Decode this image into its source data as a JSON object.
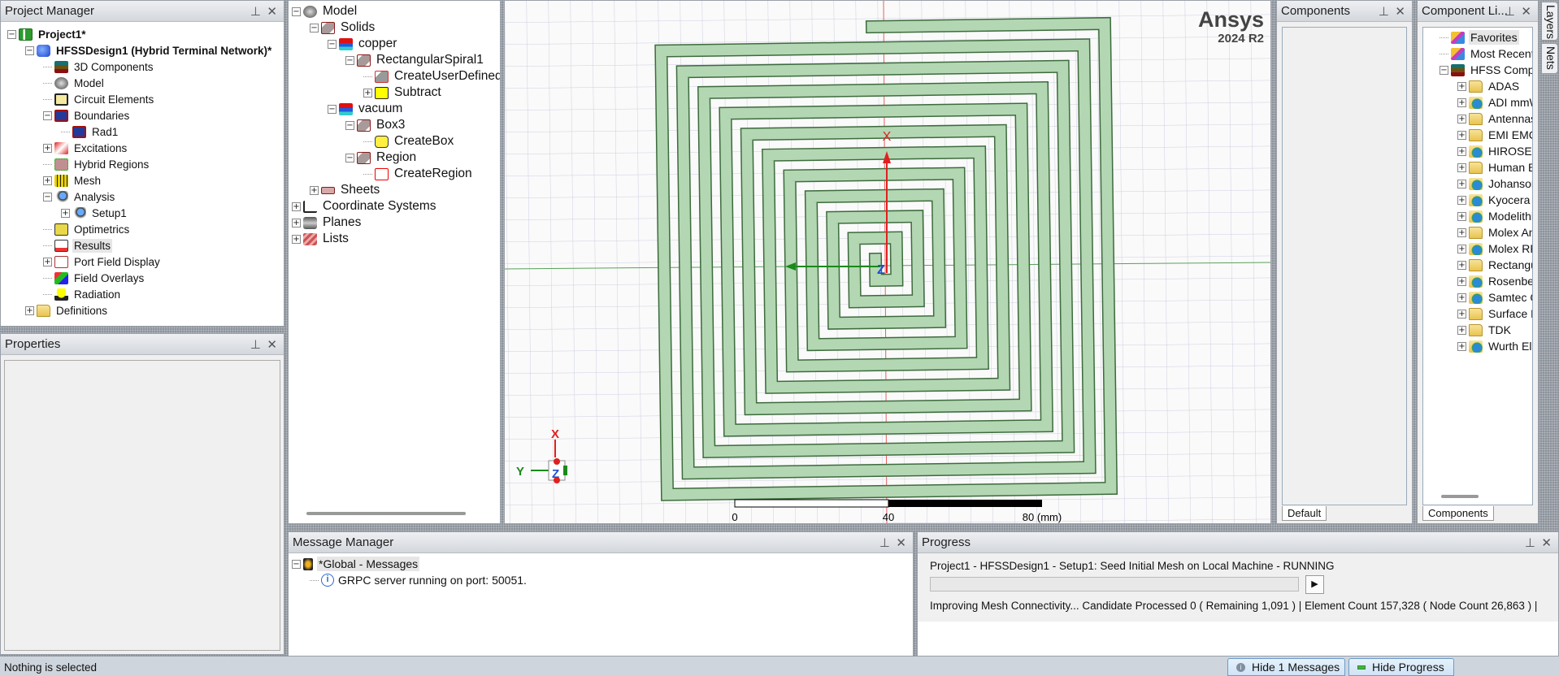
{
  "project_manager": {
    "title": "Project Manager",
    "items": [
      {
        "label": "Project1*",
        "level": 0,
        "exp": "-",
        "icon": "proj",
        "bold": true
      },
      {
        "label": "HFSSDesign1 (Hybrid Terminal Network)*",
        "level": 1,
        "exp": "-",
        "icon": "design",
        "bold": true
      },
      {
        "label": "3D Components",
        "level": 2,
        "exp": "",
        "icon": "comp"
      },
      {
        "label": "Model",
        "level": 2,
        "exp": "",
        "icon": "model"
      },
      {
        "label": "Circuit Elements",
        "level": 2,
        "exp": "",
        "icon": "circ"
      },
      {
        "label": "Boundaries",
        "level": 2,
        "exp": "-",
        "icon": "bnd"
      },
      {
        "label": "Rad1",
        "level": 3,
        "exp": "",
        "icon": "bnd"
      },
      {
        "label": "Excitations",
        "level": 2,
        "exp": "+",
        "icon": "exc"
      },
      {
        "label": "Hybrid Regions",
        "level": 2,
        "exp": "",
        "icon": "hyb"
      },
      {
        "label": "Mesh",
        "level": 2,
        "exp": "+",
        "icon": "mesh"
      },
      {
        "label": "Analysis",
        "level": 2,
        "exp": "-",
        "icon": "ana"
      },
      {
        "label": "Setup1",
        "level": 3,
        "exp": "+",
        "icon": "ana"
      },
      {
        "label": "Optimetrics",
        "level": 2,
        "exp": "",
        "icon": "opt"
      },
      {
        "label": "Results",
        "level": 2,
        "exp": "",
        "icon": "res",
        "selected": true
      },
      {
        "label": "Port Field Display",
        "level": 2,
        "exp": "+",
        "icon": "port"
      },
      {
        "label": "Field Overlays",
        "level": 2,
        "exp": "",
        "icon": "fov"
      },
      {
        "label": "Radiation",
        "level": 2,
        "exp": "",
        "icon": "rad"
      },
      {
        "label": "Definitions",
        "level": 1,
        "exp": "+",
        "icon": "folder"
      }
    ]
  },
  "properties": {
    "title": "Properties"
  },
  "model_tree": {
    "items": [
      {
        "label": "Model",
        "level": 0,
        "exp": "-",
        "icon": "model"
      },
      {
        "label": "Solids",
        "level": 1,
        "exp": "-",
        "icon": "solid"
      },
      {
        "label": "copper",
        "level": 2,
        "exp": "-",
        "icon": "mat"
      },
      {
        "label": "RectangularSpiral1",
        "level": 3,
        "exp": "-",
        "icon": "solid"
      },
      {
        "label": "CreateUserDefined",
        "level": 4,
        "exp": "",
        "icon": "op"
      },
      {
        "label": "Subtract",
        "level": 4,
        "exp": "+",
        "icon": "sub"
      },
      {
        "label": "vacuum",
        "level": 2,
        "exp": "-",
        "icon": "mat"
      },
      {
        "label": "Box3",
        "level": 3,
        "exp": "-",
        "icon": "solid"
      },
      {
        "label": "CreateBox",
        "level": 4,
        "exp": "",
        "icon": "box"
      },
      {
        "label": "Region",
        "level": 3,
        "exp": "-",
        "icon": "solid"
      },
      {
        "label": "CreateRegion",
        "level": 4,
        "exp": "",
        "icon": "region"
      },
      {
        "label": "Sheets",
        "level": 1,
        "exp": "+",
        "icon": "sheet"
      },
      {
        "label": "Coordinate Systems",
        "level": 0,
        "exp": "+",
        "icon": "cs"
      },
      {
        "label": "Planes",
        "level": 0,
        "exp": "+",
        "icon": "plane"
      },
      {
        "label": "Lists",
        "level": 0,
        "exp": "+",
        "icon": "list"
      }
    ]
  },
  "viewport": {
    "brand": "Ansys",
    "version": "2024 R2",
    "scale_labels": [
      "0",
      "40",
      "80 (mm)"
    ],
    "triad": {
      "x": "X",
      "y": "Y",
      "z": "Z"
    },
    "colors": {
      "trace_fill": "#b3d7b3",
      "trace_edge": "#3d6b3d",
      "grid": "#cdcde2",
      "x_axis": "#e02020",
      "y_axis": "#1a8a1a",
      "z_axis": "#2050d0"
    }
  },
  "components": {
    "title": "Components",
    "tab": "Default"
  },
  "component_library": {
    "title": "Component Li...",
    "tab": "Components",
    "items": [
      {
        "label": "Favorites",
        "level": 0,
        "exp": "",
        "icon": "fav",
        "selected": true
      },
      {
        "label": "Most Recently",
        "level": 0,
        "exp": "",
        "icon": "fav"
      },
      {
        "label": "HFSS Compon",
        "level": 0,
        "exp": "-",
        "icon": "lib"
      },
      {
        "label": "ADAS",
        "level": 1,
        "exp": "+",
        "icon": "folder"
      },
      {
        "label": "ADI mmWa",
        "level": 1,
        "exp": "+",
        "icon": "globe"
      },
      {
        "label": "Antennas",
        "level": 1,
        "exp": "+",
        "icon": "folder"
      },
      {
        "label": "EMI EMC",
        "level": 1,
        "exp": "+",
        "icon": "folder"
      },
      {
        "label": "HIROSE RI",
        "level": 1,
        "exp": "+",
        "icon": "globe"
      },
      {
        "label": "Human Boc",
        "level": 1,
        "exp": "+",
        "icon": "folder"
      },
      {
        "label": "Johanson",
        "level": 1,
        "exp": "+",
        "icon": "globe"
      },
      {
        "label": "Kyocera AV",
        "level": 1,
        "exp": "+",
        "icon": "globe"
      },
      {
        "label": "Modelithics",
        "level": 1,
        "exp": "+",
        "icon": "globe"
      },
      {
        "label": "Molex Ante",
        "level": 1,
        "exp": "+",
        "icon": "folder"
      },
      {
        "label": "Molex RF M",
        "level": 1,
        "exp": "+",
        "icon": "globe"
      },
      {
        "label": "Rectangula",
        "level": 1,
        "exp": "+",
        "icon": "folder"
      },
      {
        "label": "Rosenberg",
        "level": 1,
        "exp": "+",
        "icon": "globe"
      },
      {
        "label": "Samtec Co",
        "level": 1,
        "exp": "+",
        "icon": "globe"
      },
      {
        "label": "Surface Mo",
        "level": 1,
        "exp": "+",
        "icon": "folder"
      },
      {
        "label": "TDK",
        "level": 1,
        "exp": "+",
        "icon": "folder"
      },
      {
        "label": "Wurth Elekt",
        "level": 1,
        "exp": "+",
        "icon": "globe"
      }
    ]
  },
  "side_tabs": [
    "Layers",
    "Nets"
  ],
  "message_manager": {
    "title": "Message Manager",
    "group": "*Global - Messages",
    "messages": [
      "GRPC server running on port: 50051."
    ]
  },
  "progress": {
    "title": "Progress",
    "task": "Project1 - HFSSDesign1 - Setup1: Seed Initial Mesh on Local Machine - RUNNING",
    "percent": 0,
    "detail": "Improving Mesh Connectivity... Candidate Processed 0 ( Remaining 1,091 ) | Element Count 157,328 ( Node Count 26,863 ) |"
  },
  "status_bar": {
    "text": "Nothing is selected",
    "hide_messages": "Hide 1 Messages",
    "hide_progress": "Hide Progress"
  }
}
